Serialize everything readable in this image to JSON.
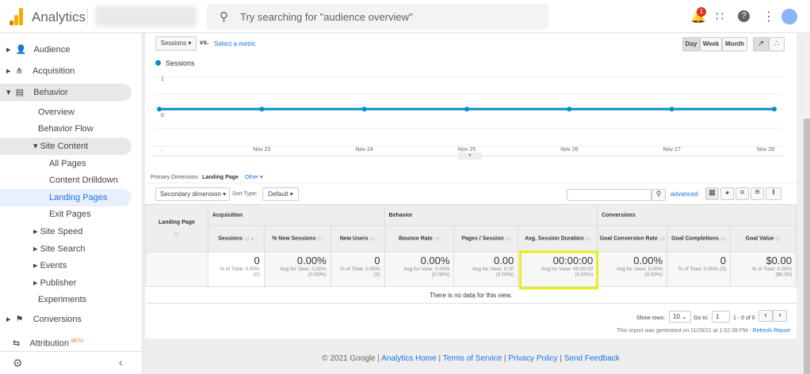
{
  "header": {
    "app_title": "Analytics",
    "search_placeholder": "Try searching for \"audience overview\"",
    "notification_count": "1"
  },
  "sidebar": {
    "items": [
      {
        "label": "Audience"
      },
      {
        "label": "Acquisition"
      },
      {
        "label": "Behavior"
      },
      {
        "label": "Overview"
      },
      {
        "label": "Behavior Flow"
      },
      {
        "label": "Site Content"
      },
      {
        "label": "All Pages"
      },
      {
        "label": "Content Drilldown"
      },
      {
        "label": "Landing Pages"
      },
      {
        "label": "Exit Pages"
      },
      {
        "label": "Site Speed"
      },
      {
        "label": "Site Search"
      },
      {
        "label": "Events"
      },
      {
        "label": "Publisher"
      },
      {
        "label": "Experiments"
      },
      {
        "label": "Conversions"
      },
      {
        "label": "Attribution"
      }
    ],
    "beta_label": "BETA"
  },
  "graph": {
    "metric_select": "Sessions",
    "vs_label": "vs.",
    "select_metric": "Select a metric",
    "periods": [
      "Day",
      "Week",
      "Month"
    ]
  },
  "chart_data": {
    "type": "line",
    "series": [
      {
        "name": "Sessions",
        "values": [
          0,
          0,
          0,
          0,
          0,
          0,
          0
        ]
      }
    ],
    "x_labels": [
      "...",
      "Nov 23",
      "Nov 24",
      "Nov 25",
      "Nov 26",
      "Nov 27",
      "Nov 28"
    ],
    "y_ticks": [
      "1",
      "0"
    ],
    "ylim": [
      0,
      1
    ],
    "color": "#058dc7"
  },
  "table": {
    "primary_dimension_label": "Primary Dimension:",
    "primary_dimension": "Landing Page",
    "other": "Other",
    "secondary_dimension": "Secondary dimension",
    "sort_type_label": "Sort Type:",
    "sort_type": "Default",
    "advanced": "advanced",
    "dim_header": "Landing Page",
    "groups": [
      "Acquisition",
      "Behavior",
      "Conversions"
    ],
    "columns": [
      {
        "label": "Sessions",
        "value": "0",
        "sub": "% of Total: 0.00% (0)"
      },
      {
        "label": "% New Sessions",
        "value": "0.00%",
        "sub": "Avg for View: 0.00% (0.00%)"
      },
      {
        "label": "New Users",
        "value": "0",
        "sub": "% of Total: 0.00% (0)"
      },
      {
        "label": "Bounce Rate",
        "value": "0.00%",
        "sub": "Avg for View: 0.00% (0.00%)"
      },
      {
        "label": "Pages / Session",
        "value": "0.00",
        "sub": "Avg for View: 0.00 (0.00%)"
      },
      {
        "label": "Avg. Session Duration",
        "value": "00:00:00",
        "sub": "Avg for View: 00:00:00 (0.00%)"
      },
      {
        "label": "Goal Conversion Rate",
        "value": "0.00%",
        "sub": "Avg for View: 0.00% (0.00%)"
      },
      {
        "label": "Goal Completions",
        "value": "0",
        "sub": "% of Total: 0.00% (0)"
      },
      {
        "label": "Goal Value",
        "value": "$0.00",
        "sub": "% of Total: 0.00% ($0.00)"
      }
    ],
    "empty_message": "There is no data for this view.",
    "highlight_color": "#e5f01a"
  },
  "pager": {
    "show_rows_label": "Show rows:",
    "show_rows": "10",
    "goto_label": "Go to:",
    "goto": "1",
    "range": "1 - 0 of 0",
    "generated": "This report was generated on 11/29/21 at 1:52:39 PM - ",
    "refresh": "Refresh Report"
  },
  "footer": {
    "copyright": "© 2021 Google",
    "links": [
      "Analytics Home",
      "Terms of Service",
      "Privacy Policy",
      "Send Feedback"
    ]
  }
}
